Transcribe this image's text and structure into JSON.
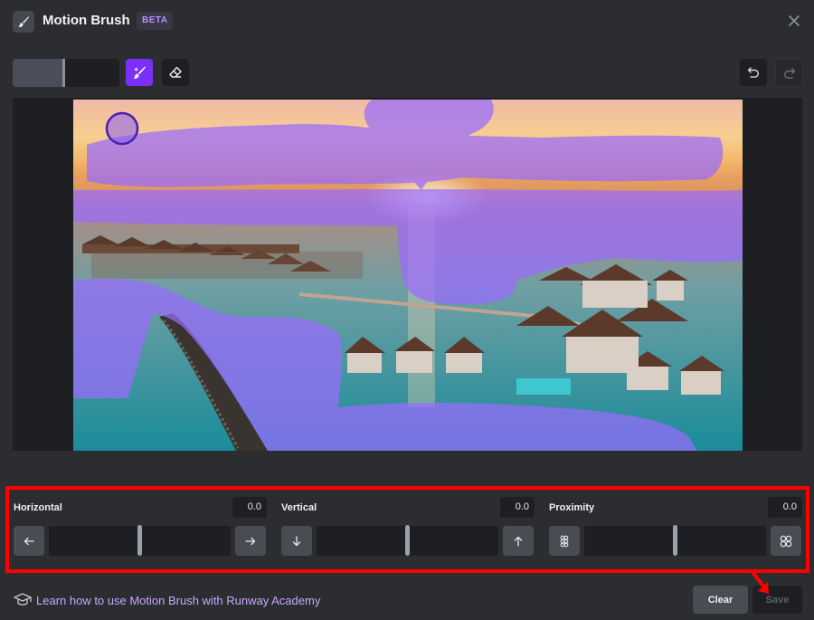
{
  "header": {
    "title": "Motion Brush",
    "badge": "BETA",
    "brush_icon": "paint-brush-icon",
    "close_icon": "close-icon"
  },
  "toolbar": {
    "brush_size_level": 0.47,
    "brush_icon": "paint-brush-icon",
    "eraser_icon": "eraser-icon",
    "undo_icon": "undo-icon",
    "redo_icon": "redo-icon",
    "accent_color": "#7b2ff7"
  },
  "canvas": {
    "image_subject": "overwater-villas-sunset",
    "mask_color": "#9a6bff"
  },
  "controls": {
    "horizontal": {
      "label": "Horizontal",
      "value": "0.0",
      "left_icon": "arrow-left-icon",
      "right_icon": "arrow-right-icon",
      "level": 0.5
    },
    "vertical": {
      "label": "Vertical",
      "value": "0.0",
      "left_icon": "arrow-down-icon",
      "right_icon": "arrow-up-icon",
      "level": 0.5
    },
    "proximity": {
      "label": "Proximity",
      "value": "0.0",
      "left_icon": "proximity-near-icon",
      "right_icon": "proximity-far-icon",
      "level": 0.5
    }
  },
  "footer": {
    "learn_icon": "graduation-cap-icon",
    "learn_text": "Learn how to use Motion Brush with Runway Academy",
    "clear_label": "Clear",
    "save_label": "Save"
  },
  "annotation": {
    "highlight_color": "#ff0000"
  }
}
